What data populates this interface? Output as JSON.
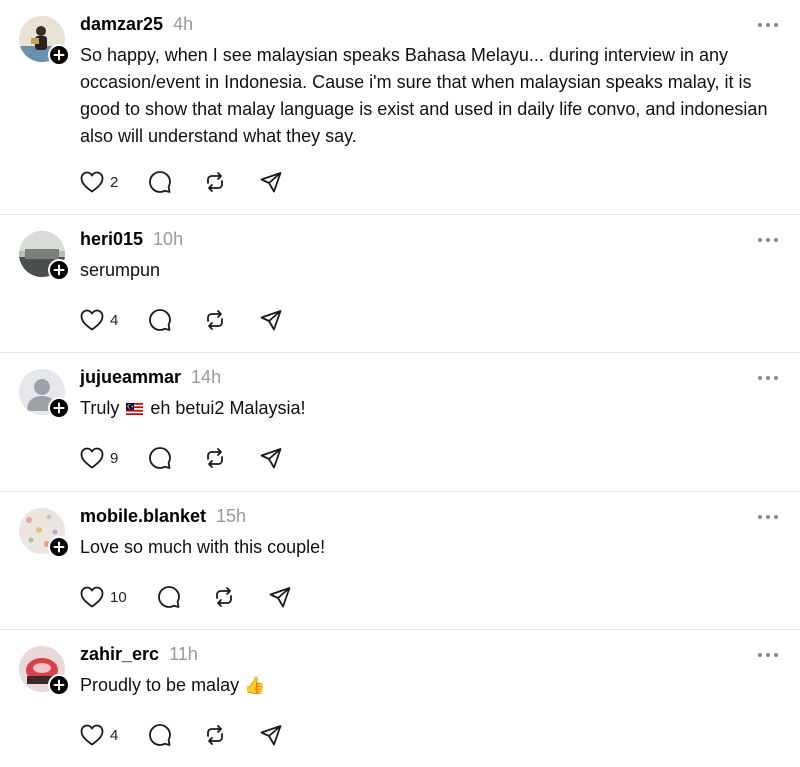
{
  "posts": [
    {
      "username": "damzar25",
      "time": "4h",
      "text": "So happy, when I see malaysian speaks Bahasa Melayu... during interview in any occasion/event in Indonesia. Cause i'm sure that when malaysian speaks malay, it is good to show that malay language is exist and used in daily life convo, and indonesian also will understand what they say.",
      "likes": "2"
    },
    {
      "username": "heri015",
      "time": "10h",
      "text": "serumpun",
      "likes": "4"
    },
    {
      "username": "jujueammar",
      "time": "14h",
      "text_before": "Truly",
      "text_after": "eh betui2 Malaysia!",
      "likes": "9"
    },
    {
      "username": "mobile.blanket",
      "time": "15h",
      "text": "Love so much with this couple!",
      "likes": "10"
    },
    {
      "username": "zahir_erc",
      "time": "11h",
      "text": "Proudly to be malay",
      "emoji": "👍",
      "likes": "4"
    }
  ],
  "icons": {
    "like": "heart-icon",
    "reply": "comment-icon",
    "repost": "repost-icon",
    "share": "send-icon",
    "more": "more-icon",
    "follow": "plus-icon"
  },
  "colors": {
    "text": "#000000",
    "muted": "#9a9a9a",
    "divider": "#e4e4e4",
    "badge": "#000000"
  }
}
